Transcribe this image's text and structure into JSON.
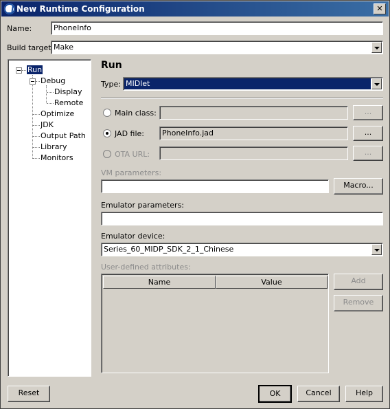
{
  "window": {
    "title": "New Runtime Configuration",
    "close_symbol": "✕"
  },
  "form": {
    "name_label": "Name:",
    "name_value": "PhoneInfo",
    "build_target_label": "Build target:",
    "build_target_value": "Make"
  },
  "tree": {
    "items": [
      {
        "label": "Run"
      },
      {
        "label": "Debug"
      },
      {
        "label": "Display"
      },
      {
        "label": "Remote"
      },
      {
        "label": "Optimize"
      },
      {
        "label": "JDK"
      },
      {
        "label": "Output Path"
      },
      {
        "label": "Library"
      },
      {
        "label": "Monitors"
      }
    ]
  },
  "panel": {
    "title": "Run",
    "type_label": "Type:",
    "type_value": "MIDlet",
    "main_class_label": "Main class:",
    "main_class_value": "",
    "jad_file_label": "JAD file:",
    "jad_file_value": "PhoneInfo.jad",
    "ota_url_label": "OTA URL:",
    "ota_url_value": "",
    "browse_label": "...",
    "vm_params_label": "VM parameters:",
    "vm_params_value": "",
    "macro_label": "Macro...",
    "emulator_params_label": "Emulator parameters:",
    "emulator_params_value": "",
    "emulator_device_label": "Emulator device:",
    "emulator_device_value": "Series_60_MIDP_SDK_2_1_Chinese",
    "attributes_label": "User-defined attributes:",
    "columns": [
      "Name",
      "Value"
    ],
    "add_label": "Add",
    "remove_label": "Remove"
  },
  "footer": {
    "reset_label": "Reset",
    "ok_label": "OK",
    "cancel_label": "Cancel",
    "help_label": "Help"
  },
  "colors": {
    "selection": "#0a246a",
    "titlebar_start": "#0a246a",
    "titlebar_end": "#3a6ea5",
    "face": "#d4d0c8"
  }
}
